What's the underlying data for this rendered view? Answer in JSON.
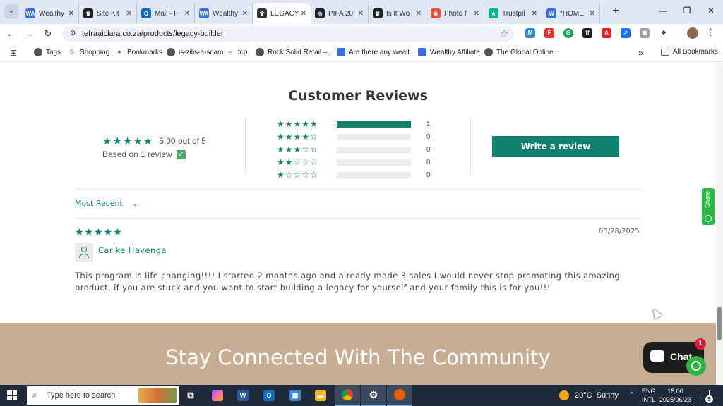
{
  "browser": {
    "tabs": [
      {
        "title": "Wealthy",
        "icon": "wealthy-affiliate-icon",
        "color": "#3a6fd8",
        "letter": "WA"
      },
      {
        "title": "Site Kit",
        "icon": "site-kit-icon",
        "color": "#222222",
        "letter": "♛"
      },
      {
        "title": "Mail - F",
        "icon": "outlook-icon",
        "color": "#0f6cbd",
        "letter": "O"
      },
      {
        "title": "Wealthy",
        "icon": "wealthy-affiliate-icon",
        "color": "#3a6fd8",
        "letter": "WA"
      },
      {
        "title": "LEGACY",
        "icon": "legacy-icon",
        "color": "#333333",
        "letter": "♛"
      },
      {
        "title": "PIFA 20",
        "icon": "pifa-icon",
        "color": "#222222",
        "letter": "◎"
      },
      {
        "title": "Is it Wo",
        "icon": "site-kit-icon",
        "color": "#222222",
        "letter": "♛"
      },
      {
        "title": "Photo f",
        "icon": "google-photos-icon",
        "color": "#e0533d",
        "letter": "❀"
      },
      {
        "title": "Trustpil",
        "icon": "trustpilot-icon",
        "color": "#00b67a",
        "letter": "★"
      },
      {
        "title": "*HOME",
        "icon": "wordpress-icon",
        "color": "#3a6fd8",
        "letter": "W"
      }
    ],
    "active_tab": 4,
    "url": "tefraaiclara.co.za/products/legacy-builder",
    "bookmarks": [
      {
        "label": "Tags",
        "icon": "globe-icon"
      },
      {
        "label": "Shopping",
        "icon": "google-icon"
      },
      {
        "label": "Bookmarks",
        "icon": "star-icon"
      },
      {
        "label": "is-zilis-a-scam",
        "icon": "globe-icon"
      },
      {
        "label": "tcp",
        "icon": "link-icon"
      },
      {
        "label": "Rock Solid Retail –...",
        "icon": "globe-icon"
      },
      {
        "label": "Are there any wealt...",
        "icon": "wealthy-affiliate-icon"
      },
      {
        "label": "Wealthy Affiliate",
        "icon": "wealthy-affiliate-icon"
      },
      {
        "label": "The Global Online...",
        "icon": "globe-icon"
      }
    ],
    "all_bookmarks": "All Bookmarks"
  },
  "reviews": {
    "title": "Customer Reviews",
    "average": "5.00 out of 5",
    "based_on": "Based on 1 review",
    "histogram": [
      {
        "stars": "★★★★★",
        "count": "1",
        "fill": 1.0
      },
      {
        "stars": "★★★★☆",
        "count": "0",
        "fill": 0
      },
      {
        "stars": "★★★☆☆",
        "count": "0",
        "fill": 0
      },
      {
        "stars": "★★☆☆☆",
        "count": "0",
        "fill": 0
      },
      {
        "stars": "★☆☆☆☆",
        "count": "0",
        "fill": 0
      }
    ],
    "write_button": "Write a review",
    "sort_label": "Most Recent",
    "items": [
      {
        "stars": "★★★★★",
        "date": "05/28/2025",
        "author": "Carike Havenga",
        "body": "This program is life changing!!!! I started 2 months ago and already made 3 sales I would never stop promoting this amazing product, if you are stuck and you want to start building a legacy for yourself and your family this is for you!!!"
      }
    ]
  },
  "community": {
    "title": "Stay Connected With The Community"
  },
  "widgets": {
    "share": "Share",
    "chat": "Chat",
    "chat_badge": "1"
  },
  "taskbar": {
    "search_placeholder": "Type here to search",
    "weather": "20°C  Sunny",
    "lang": [
      "ENG",
      "INTL"
    ],
    "time": "15:00",
    "date": "2025/06/23",
    "notifications": "5"
  },
  "colors": {
    "accent": "#12806f",
    "community_bg": "#c8ad95"
  }
}
